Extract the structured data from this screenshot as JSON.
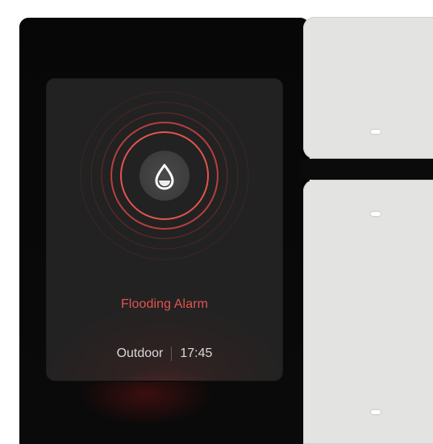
{
  "alarm": {
    "title": "Flooding Alarm",
    "location": "Outdoor",
    "time": "17:45",
    "icon": "water-drop-icon",
    "accent_color": "#e3544f"
  },
  "device": {
    "keys": [
      {
        "name": "upper-key",
        "indicator": "indicator-light"
      },
      {
        "name": "lower-key",
        "indicator": "indicator-light"
      }
    ]
  }
}
